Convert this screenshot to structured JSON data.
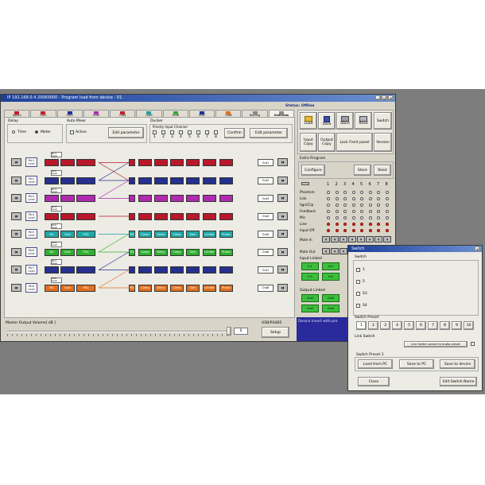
{
  "main_window": {
    "title": "IP 192.168.0.4  20060000 - Program load from device - 01.",
    "status": "Status: Offline",
    "tabs": [
      "Inputs",
      "Out1",
      "Out2",
      "Out3",
      "Out4",
      "Out5",
      "Out6",
      "Out7",
      "Out8",
      "Routing",
      "Overview"
    ],
    "tab_colors": [
      "#c02030",
      "#c02030",
      "#2030a0",
      "#b030b0",
      "#c02030",
      "#20a0a0",
      "#30b030",
      "#2030a0",
      "#e07020",
      "#888888",
      "#888888"
    ]
  },
  "delay": {
    "label": "Delay",
    "options": [
      "Time",
      "Meter"
    ]
  },
  "auto_mixer": {
    "label": "Auto Mixer",
    "active_label": "Active",
    "edit_label": "Edit parameter"
  },
  "ducker": {
    "label": "Ducker",
    "priority_label": "Priority Input Channel",
    "channel_numbers": [
      "1",
      "2",
      "3",
      "4",
      "5",
      "6",
      "7",
      "8"
    ],
    "confirm_label": "Confirm",
    "edit_label": "Edit parameter"
  },
  "signal_rows": [
    {
      "input": "Mic1 Level",
      "color": "#b8182a",
      "blocks": [
        "",
        "",
        "",
        "",
        "",
        "",
        "",
        "",
        "",
        ""
      ],
      "output": "Out1"
    },
    {
      "input": "Mic2 Level",
      "color": "#26308e",
      "blocks": [
        "",
        "",
        "",
        "",
        "",
        "",
        "",
        "",
        "",
        ""
      ],
      "output": "Out2"
    },
    {
      "input": "Mic3 Level",
      "color": "#b02ab0",
      "blocks": [
        "",
        "",
        "",
        "",
        "",
        "",
        "",
        "",
        "",
        ""
      ],
      "output": "Out3"
    },
    {
      "input": "Mic4 Level",
      "color": "#b8182a",
      "blocks": [
        "",
        "",
        "",
        "",
        "",
        "",
        "",
        "",
        "",
        ""
      ],
      "output": "Out4"
    },
    {
      "input": "Mic5 Level",
      "color": "#1ea8a8",
      "blocks": [
        "NG",
        "Gain",
        "PEQ",
        "PEQ",
        "Comp",
        "Delay",
        "Comp",
        "Gain",
        "Limiter",
        "Phase"
      ],
      "output": "Out5"
    },
    {
      "input": "Mic6 Level",
      "color": "#30b030",
      "blocks": [
        "NG",
        "Gain",
        "PEQ",
        "PEQ",
        "Comp",
        "Delay",
        "Comp",
        "Gain",
        "Limiter",
        "Phase"
      ],
      "output": "Out6"
    },
    {
      "input": "Mic7 Level",
      "color": "#26308e",
      "blocks": [
        "",
        "",
        "",
        "",
        "",
        "",
        "",
        "",
        "",
        ""
      ],
      "output": "Out7"
    },
    {
      "input": "Mic8 Level",
      "color": "#e07020",
      "blocks": [
        "NG",
        "Gain",
        "PEQ",
        "PEQ",
        "Comp",
        "Delay",
        "Comp",
        "Gain",
        "Limiter",
        "Phase"
      ],
      "output": "Out8"
    }
  ],
  "toolbar": {
    "load": "Load",
    "save": "Save",
    "store": "Store",
    "read": "Read",
    "switch": "Switch",
    "input_copy": "Input Copy",
    "output_copy": "Output Copy",
    "lock_front": "Lock Front panel",
    "version": "Version"
  },
  "extra_program": {
    "label": "Extra Program",
    "configure": "Configure",
    "store": "Store",
    "read": "Read"
  },
  "status_grid": {
    "channel_numbers": [
      "1",
      "2",
      "3",
      "4",
      "5",
      "6",
      "7",
      "8"
    ],
    "rows": [
      "Phantom",
      "Link",
      "Sgn/Clip",
      "Feedback",
      "Mic",
      "Line",
      "Input Off"
    ],
    "red_rows": [
      "Line",
      "Input Off"
    ]
  },
  "mute_in": {
    "label": "Mute In"
  },
  "mute_out": {
    "label": "Mute Out"
  },
  "input_linked": {
    "label": "Input Linked",
    "buttons": [
      "In1",
      "In2",
      "In3",
      "In4"
    ]
  },
  "output_linked": {
    "label": "Output Linked",
    "buttons": [
      "Out1",
      "Out2",
      "Out3",
      "Out4"
    ]
  },
  "master": {
    "label": "Master Output Volume[ dB ]",
    "value": "0",
    "connection": "USB/RS485",
    "setup": "Setup"
  },
  "console_text": "Device insert with pro",
  "switch_dialog": {
    "title": "Switch",
    "group_label": "Switch",
    "options": [
      "1",
      "5",
      "S3",
      "S4"
    ],
    "preset_label": "Switch Preset",
    "preset_numbers": [
      "1",
      "2",
      "3",
      "4",
      "5",
      "6",
      "7",
      "8",
      "9",
      "10"
    ],
    "link_label": "Link Switch",
    "link_button": "Link Switch preset to Audio preset",
    "preset1_label": "Switch Preset 1",
    "load_pc": "Load from PC",
    "save_pc": "Save to PC",
    "save_device": "Save to device",
    "close": "Close",
    "edit_name": "Edit Switch Name"
  }
}
